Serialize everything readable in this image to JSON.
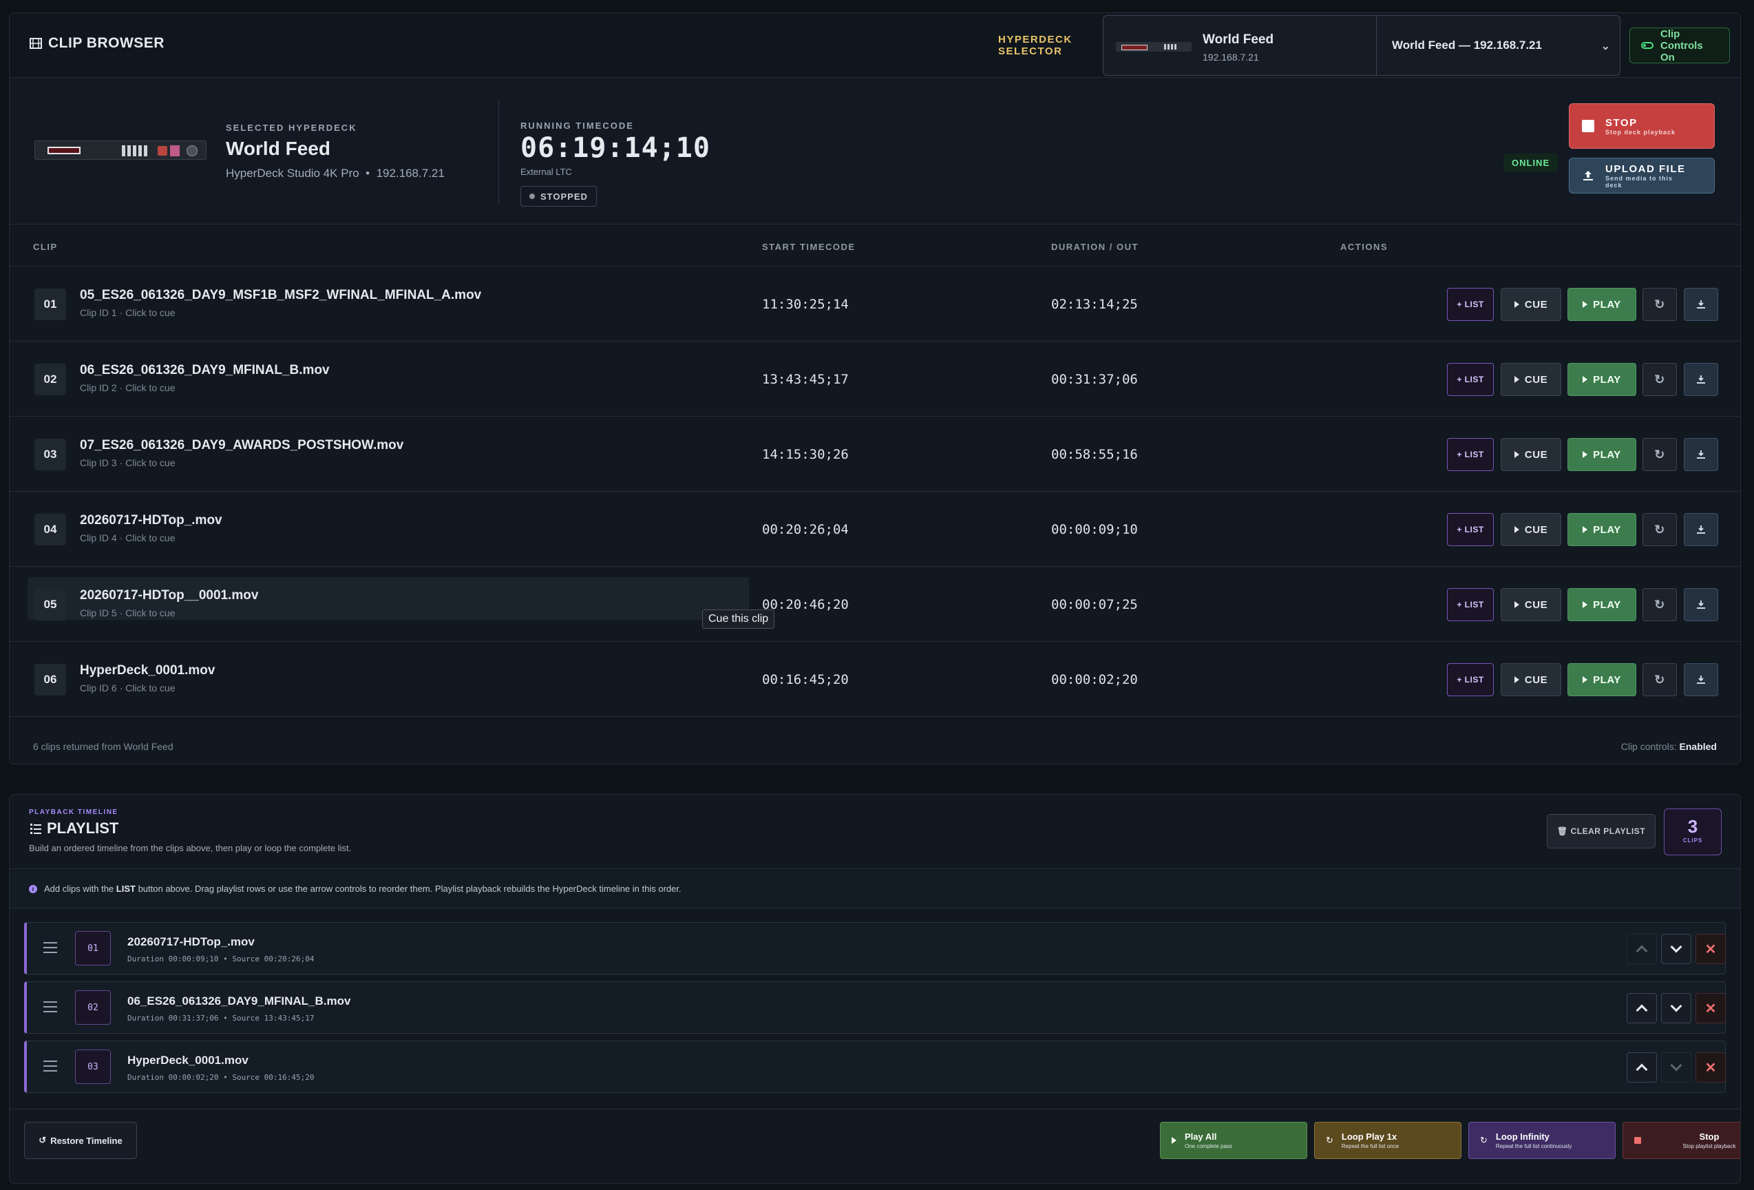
{
  "app": {
    "title": "CLIP BROWSER"
  },
  "selector": {
    "label_line1": "HYPERDECK",
    "label_line2": "SELECTOR",
    "deck_name": "World Feed",
    "deck_ip": "192.168.7.21",
    "dropdown_value": "World Feed — 192.168.7.21",
    "controls_toggle_label": "Clip Controls On"
  },
  "selected_deck": {
    "label": "SELECTED HYPERDECK",
    "name": "World Feed",
    "model": "HyperDeck Studio 4K Pro",
    "ip": "192.168.7.21",
    "timecode_label": "RUNNING TIMECODE",
    "timecode": "06:19:14;10",
    "timecode_source": "External LTC",
    "transport_state": "STOPPED",
    "connection": "ONLINE"
  },
  "deck_actions": {
    "stop_label": "STOP",
    "stop_sub": "Stop deck playback",
    "upload_label": "UPLOAD FILE",
    "upload_sub": "Send media to this deck"
  },
  "clip_table": {
    "headers": {
      "clip": "CLIP",
      "start": "START TIMECODE",
      "duration": "DURATION / OUT",
      "actions": "ACTIONS"
    },
    "action_labels": {
      "list": "+ LIST",
      "cue": "CUE",
      "play": "PLAY"
    },
    "rows": [
      {
        "num": "01",
        "name": "05_ES26_061326_DAY9_MSF1B_MSF2_WFINAL_MFINAL_A.mov",
        "sub": "Clip ID 1 · Click to cue",
        "start": "11:30:25;14",
        "duration": "02:13:14;25"
      },
      {
        "num": "02",
        "name": "06_ES26_061326_DAY9_MFINAL_B.mov",
        "sub": "Clip ID 2 · Click to cue",
        "start": "13:43:45;17",
        "duration": "00:31:37;06"
      },
      {
        "num": "03",
        "name": "07_ES26_061326_DAY9_AWARDS_POSTSHOW.mov",
        "sub": "Clip ID 3 · Click to cue",
        "start": "14:15:30;26",
        "duration": "00:58:55;16"
      },
      {
        "num": "04",
        "name": "20260717-HDTop_.mov",
        "sub": "Clip ID 4 · Click to cue",
        "start": "00:20:26;04",
        "duration": "00:00:09;10"
      },
      {
        "num": "05",
        "name": "20260717-HDTop__0001.mov",
        "sub": "Clip ID 5 · Click to cue",
        "start": "00:20:46;20",
        "duration": "00:00:07;25"
      },
      {
        "num": "06",
        "name": "HyperDeck_0001.mov",
        "sub": "Clip ID 6 · Click to cue",
        "start": "00:16:45;20",
        "duration": "00:00:02;20"
      }
    ],
    "tooltip": "Cue this clip",
    "footer_count": "6 clips returned from World Feed",
    "footer_status_label": "Clip controls:",
    "footer_status_value": "Enabled"
  },
  "playlist": {
    "kicker": "PLAYBACK TIMELINE",
    "title": "PLAYLIST",
    "description": "Build an ordered timeline from the clips above, then play or loop the complete list.",
    "clear_label": "CLEAR PLAYLIST",
    "count": "3",
    "count_label": "CLIPS",
    "info_prefix": "Add clips with the ",
    "info_bold": "LIST",
    "info_suffix": " button above. Drag playlist rows or use the arrow controls to reorder them. Playlist playback rebuilds the HyperDeck timeline in this order.",
    "items": [
      {
        "num": "01",
        "name": "20260717-HDTop_.mov",
        "meta": "Duration 00:00:09;10 • Source 00:20:26;04"
      },
      {
        "num": "02",
        "name": "06_ES26_061326_DAY9_MFINAL_B.mov",
        "meta": "Duration 00:31:37;06 • Source 13:43:45;17"
      },
      {
        "num": "03",
        "name": "HyperDeck_0001.mov",
        "meta": "Duration 00:00:02;20 • Source 00:16:45;20"
      }
    ],
    "restore_label": "Restore Timeline",
    "actions": {
      "play_all": "Play All",
      "play_all_sub": "One complete pass",
      "loop_1x": "Loop Play 1x",
      "loop_1x_sub": "Repeat the full list once",
      "loop_inf": "Loop Infinity",
      "loop_inf_sub": "Repeat the full list continuously",
      "stop": "Stop",
      "stop_sub": "Stop playlist playback"
    }
  },
  "colors": {
    "accent_purple": "#8b6cd6",
    "play_green": "#3d7d4d",
    "stop_red": "#c6403f",
    "selector_yellow": "#e9c46a"
  }
}
